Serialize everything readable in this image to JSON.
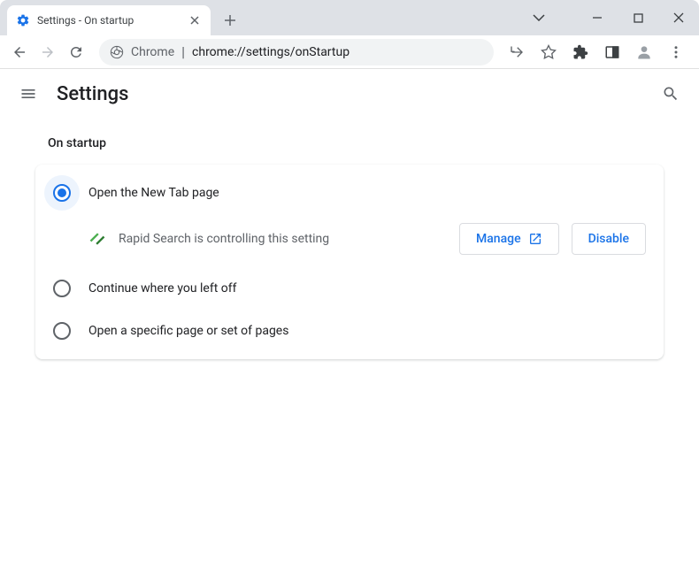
{
  "titlebar": {
    "tab_title": "Settings - On startup"
  },
  "toolbar": {
    "url_prefix": "Chrome",
    "url_path": "chrome://settings/onStartup"
  },
  "header": {
    "title": "Settings"
  },
  "section": {
    "title": "On startup",
    "options": [
      {
        "label": "Open the New Tab page",
        "selected": true
      },
      {
        "label": "Continue where you left off",
        "selected": false
      },
      {
        "label": "Open a specific page or set of pages",
        "selected": false
      }
    ],
    "controlled": {
      "extension_name": "Rapid Search",
      "text": "Rapid Search is controlling this setting",
      "manage_label": "Manage",
      "disable_label": "Disable"
    }
  }
}
